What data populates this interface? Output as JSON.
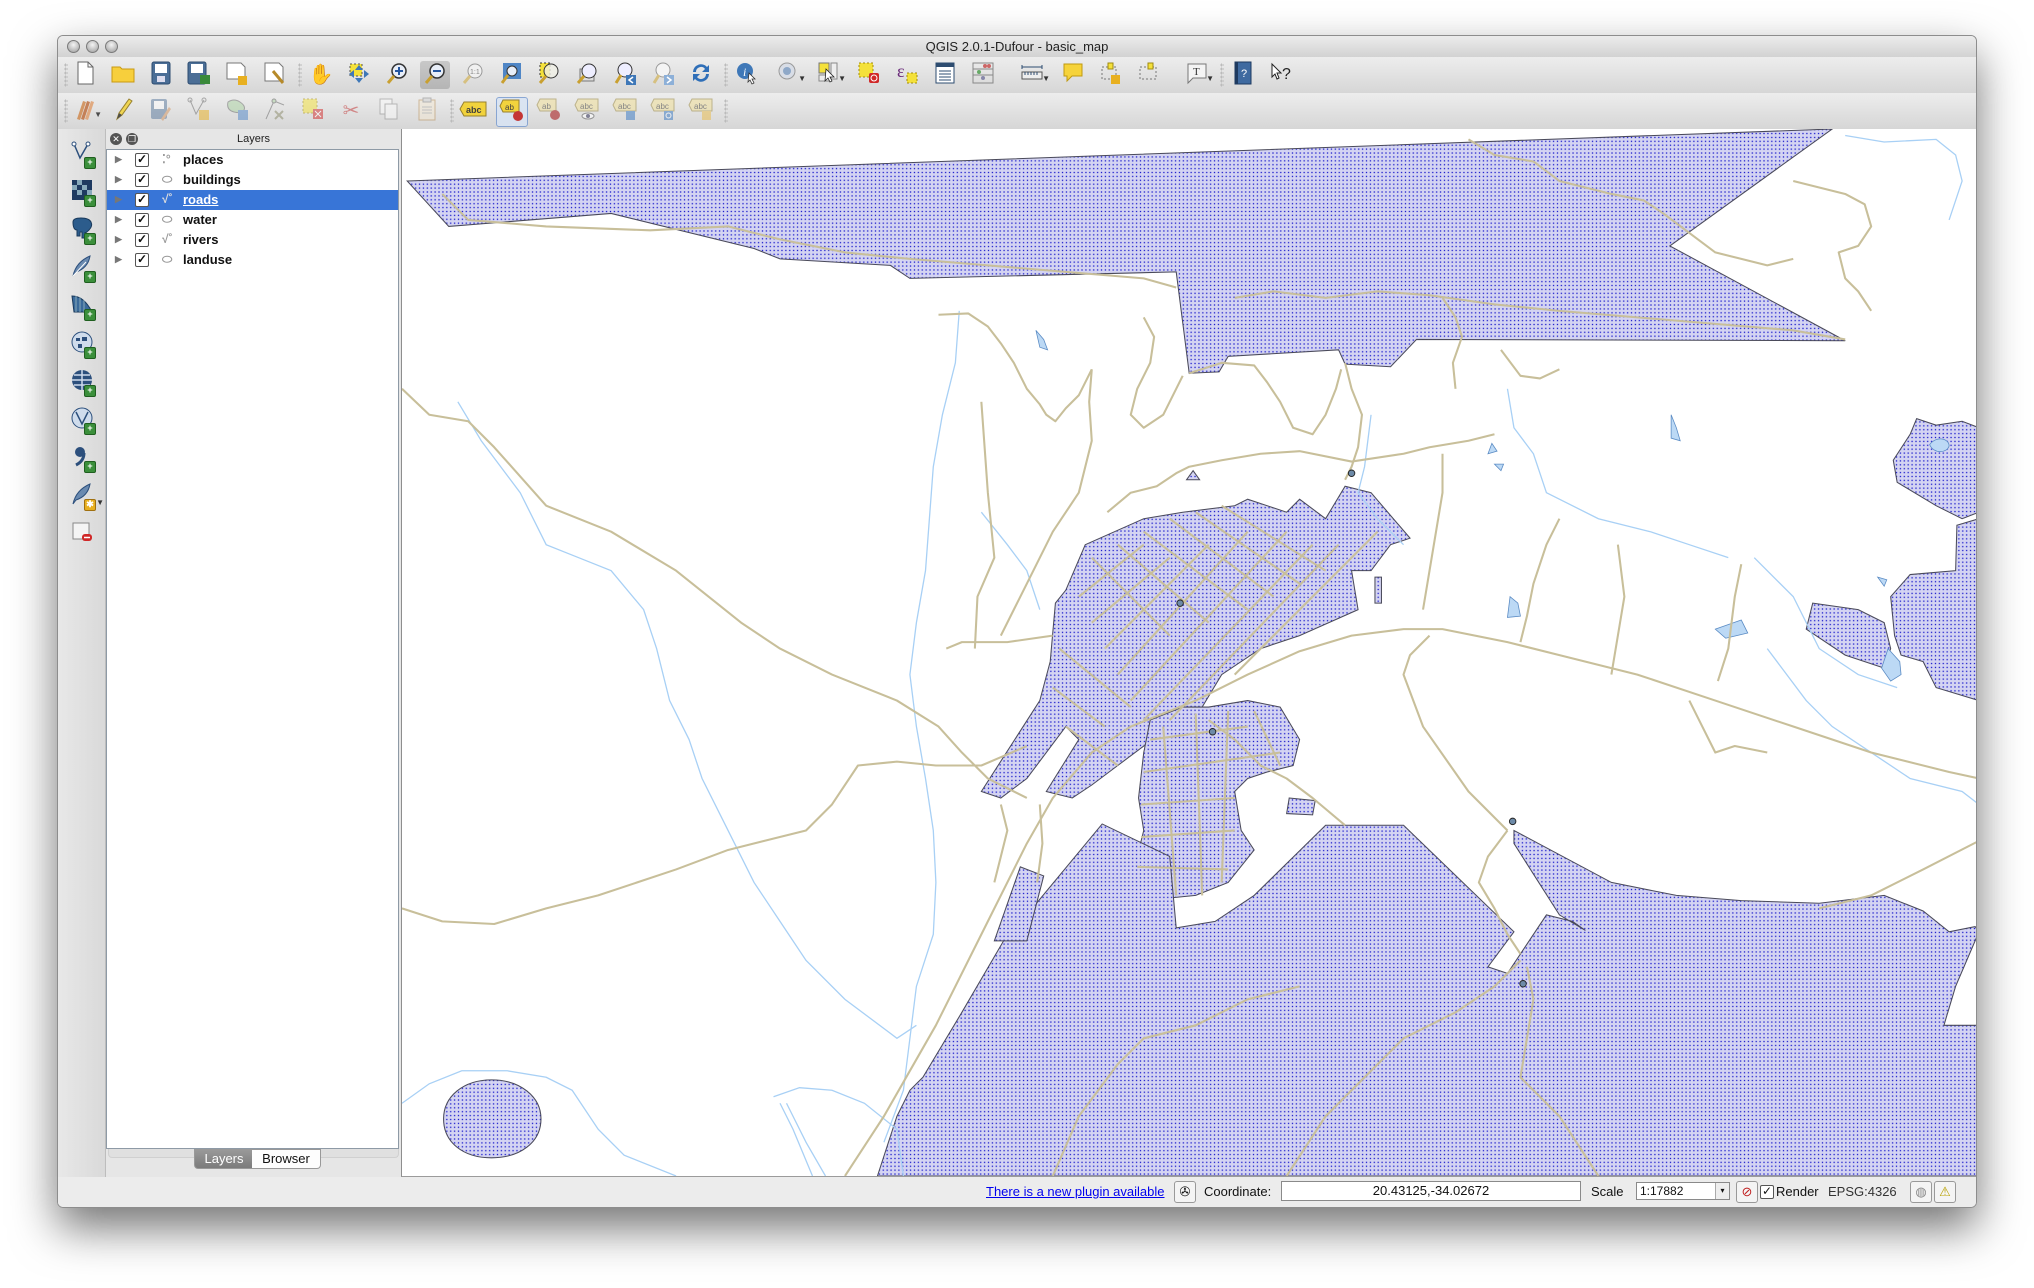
{
  "window": {
    "title": "QGIS 2.0.1-Dufour - basic_map"
  },
  "toolbar_file": [
    {
      "name": "new-project",
      "icon": "new-document-icon"
    },
    {
      "name": "open-project",
      "icon": "folder-icon"
    },
    {
      "name": "save-project",
      "icon": "save-icon"
    },
    {
      "name": "save-project-as",
      "icon": "save-as-icon"
    },
    {
      "name": "new-print-composer",
      "icon": "new-composer-icon"
    },
    {
      "name": "composer-manager",
      "icon": "composer-manager-icon"
    }
  ],
  "toolbar_nav": [
    {
      "name": "pan",
      "icon": "hand-icon"
    },
    {
      "name": "pan-to-selection",
      "icon": "pan-selection-icon"
    },
    {
      "name": "zoom-in",
      "icon": "zoom-in-icon"
    },
    {
      "name": "zoom-out",
      "icon": "zoom-out-icon",
      "active": true
    },
    {
      "name": "zoom-native",
      "icon": "zoom-1to1-icon"
    },
    {
      "name": "zoom-full",
      "icon": "zoom-full-icon"
    },
    {
      "name": "zoom-selection",
      "icon": "zoom-selection-icon"
    },
    {
      "name": "zoom-layer",
      "icon": "zoom-layer-icon"
    },
    {
      "name": "zoom-last",
      "icon": "zoom-last-icon"
    },
    {
      "name": "zoom-next",
      "icon": "zoom-next-icon"
    },
    {
      "name": "refresh",
      "icon": "refresh-icon"
    }
  ],
  "toolbar_attr": [
    {
      "name": "identify",
      "icon": "identify-icon"
    },
    {
      "name": "run-action",
      "icon": "action-icon",
      "dropdown": true
    },
    {
      "name": "select-features",
      "icon": "select-icon",
      "dropdown": true
    },
    {
      "name": "deselect-all",
      "icon": "deselect-icon"
    },
    {
      "name": "field-calculator",
      "icon": "epsilon-icon"
    },
    {
      "name": "attribute-table",
      "icon": "table-icon"
    },
    {
      "name": "statistics",
      "icon": "abacus-icon"
    },
    {
      "name": "measure",
      "icon": "ruler-icon",
      "dropdown": true
    },
    {
      "name": "map-tips",
      "icon": "speech-bubble-icon"
    },
    {
      "name": "new-bookmark",
      "icon": "new-bookmark-icon"
    },
    {
      "name": "show-bookmarks",
      "icon": "bookmarks-icon"
    },
    {
      "name": "text-annotation",
      "icon": "text-annotation-icon",
      "dropdown": true
    }
  ],
  "toolbar_help": [
    {
      "name": "help-contents",
      "icon": "help-book-icon"
    },
    {
      "name": "whats-this",
      "icon": "whats-this-icon"
    }
  ],
  "toolbar_edit": [
    {
      "name": "current-edits",
      "icon": "pencils-icon",
      "dropdown": true
    },
    {
      "name": "toggle-editing",
      "icon": "pencil-icon"
    },
    {
      "name": "save-edits",
      "icon": "save-edits-icon"
    },
    {
      "name": "add-feature",
      "icon": "add-feature-icon"
    },
    {
      "name": "move-feature",
      "icon": "move-feature-icon"
    },
    {
      "name": "node-tool",
      "icon": "node-tool-icon"
    },
    {
      "name": "delete-selected",
      "icon": "delete-selected-icon"
    },
    {
      "name": "cut-features",
      "icon": "scissors-icon"
    },
    {
      "name": "copy-features",
      "icon": "copy-icon"
    },
    {
      "name": "paste-features",
      "icon": "clipboard-icon"
    }
  ],
  "toolbar_label": [
    {
      "name": "layer-labeling",
      "icon": "abc-label-icon",
      "text": "abc"
    },
    {
      "name": "pin-labels",
      "icon": "pin-label-icon",
      "text": "ab"
    },
    {
      "name": "highlight-pinned",
      "icon": "highlight-label-icon",
      "text": "ab"
    },
    {
      "name": "show-hide-labels",
      "icon": "show-label-icon",
      "text": "abc"
    },
    {
      "name": "move-label",
      "icon": "move-label-icon",
      "text": "abc"
    },
    {
      "name": "rotate-label",
      "icon": "rotate-label-icon",
      "text": "abc"
    },
    {
      "name": "change-label",
      "icon": "change-label-icon",
      "text": "abc"
    }
  ],
  "left_toolbar": [
    {
      "name": "add-vector-layer",
      "icon": "vector-layer-icon"
    },
    {
      "name": "add-raster-layer",
      "icon": "raster-layer-icon"
    },
    {
      "name": "add-postgis-layer",
      "icon": "postgis-elephant-icon"
    },
    {
      "name": "add-spatialite-layer",
      "icon": "spatialite-feather-icon"
    },
    {
      "name": "add-mssql-layer",
      "icon": "mssql-icon"
    },
    {
      "name": "add-wms-layer",
      "icon": "wms-globe-icon"
    },
    {
      "name": "add-wcs-layer",
      "icon": "wcs-globe-icon"
    },
    {
      "name": "add-wfs-layer",
      "icon": "wfs-globe-icon"
    },
    {
      "name": "add-delimited-text-layer",
      "icon": "comma-icon"
    },
    {
      "name": "new-spatialite-layer",
      "icon": "new-feather-icon"
    },
    {
      "name": "remove-layer",
      "icon": "remove-layer-icon"
    }
  ],
  "layers_panel": {
    "title": "Layers",
    "layers": [
      {
        "name": "places",
        "type": "point",
        "checked": true,
        "selected": false
      },
      {
        "name": "buildings",
        "type": "polygon",
        "checked": true,
        "selected": false
      },
      {
        "name": "roads",
        "type": "line",
        "checked": true,
        "selected": true
      },
      {
        "name": "water",
        "type": "polygon",
        "checked": true,
        "selected": false
      },
      {
        "name": "rivers",
        "type": "line",
        "checked": true,
        "selected": false
      },
      {
        "name": "landuse",
        "type": "polygon",
        "checked": true,
        "selected": false
      }
    ],
    "tabs": [
      {
        "label": "Layers",
        "active": true
      },
      {
        "label": "Browser",
        "active": false
      }
    ]
  },
  "map": {
    "colors": {
      "landuse_fill": "#d4d4f2",
      "landuse_dots": "#1a1acc",
      "landuse_stroke": "#4a4a5a",
      "roads": "#c8bf9a",
      "rivers": "#a8d0f5",
      "water_fill": "#bcd9f5",
      "water_stroke": "#5a8bc4",
      "places": "#6d8aa8"
    }
  },
  "statusbar": {
    "plugin_message": "There is a new plugin available",
    "coordinate_label": "Coordinate:",
    "coordinate_value": "20.43125,-34.02672",
    "scale_label": "Scale",
    "scale_value": "1:17882",
    "render_label": "Render",
    "render_checked": true,
    "crs": "EPSG:4326"
  }
}
